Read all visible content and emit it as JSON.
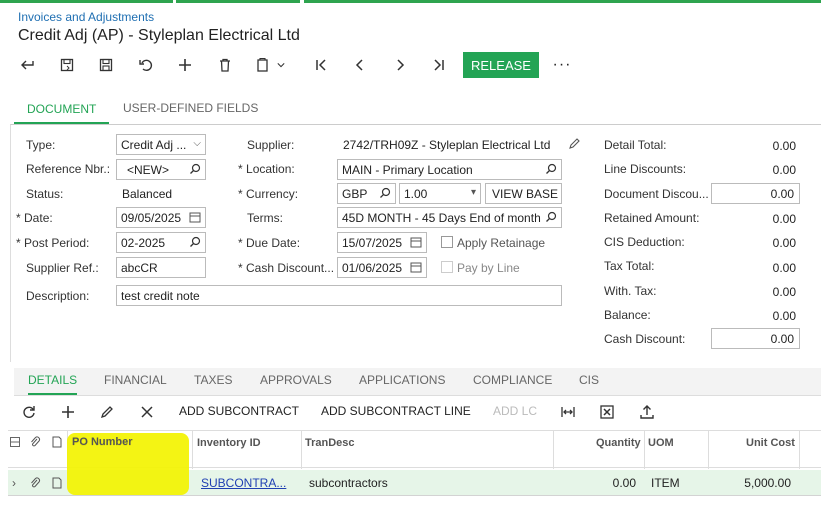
{
  "breadcrumb": "Invoices and Adjustments",
  "title": "Credit Adj (AP) - Styleplan Electrical Ltd",
  "toolbar": {
    "release_label": "RELEASE",
    "more_label": "···"
  },
  "top_tabs": [
    {
      "label": "DOCUMENT",
      "active": true
    },
    {
      "label": "USER-DEFINED FIELDS",
      "active": false
    }
  ],
  "form": {
    "type": {
      "label": "Type:",
      "value": "Credit Adj ..."
    },
    "ref": {
      "label": "Reference Nbr.:",
      "value": "<NEW>"
    },
    "status": {
      "label": "Status:",
      "value": "Balanced"
    },
    "date": {
      "label": "Date:",
      "value": "09/05/2025"
    },
    "post_period": {
      "label": "Post Period:",
      "value": "02-2025"
    },
    "supplier_ref": {
      "label": "Supplier Ref.:",
      "value": "abcCR"
    },
    "description": {
      "label": "Description:",
      "value": "test credit note"
    },
    "supplier": {
      "label": "Supplier:",
      "value": "2742/TRH09Z - Styleplan Electrical Ltd"
    },
    "location": {
      "label": "Location:",
      "value": "MAIN - Primary Location"
    },
    "currency": {
      "label": "Currency:",
      "value": "GBP",
      "rate": "1.00",
      "view_base": "VIEW BASE"
    },
    "terms": {
      "label": "Terms:",
      "value": "45D MONTH - 45 Days End of month"
    },
    "due_date": {
      "label": "Due Date:",
      "value": "15/07/2025"
    },
    "cash_discount_date": {
      "label": "Cash Discount...",
      "value": "01/06/2025"
    },
    "apply_retainage": "Apply Retainage",
    "pay_by_line": "Pay by Line"
  },
  "totals": [
    {
      "label": "Detail Total:",
      "value": "0.00",
      "editable": false
    },
    {
      "label": "Line Discounts:",
      "value": "0.00",
      "editable": false
    },
    {
      "label": "Document Discou...",
      "value": "0.00",
      "editable": true
    },
    {
      "label": "Retained Amount:",
      "value": "0.00",
      "editable": false
    },
    {
      "label": "CIS Deduction:",
      "value": "0.00",
      "editable": false
    },
    {
      "label": "Tax Total:",
      "value": "0.00",
      "editable": false
    },
    {
      "label": "With. Tax:",
      "value": "0.00",
      "editable": false
    },
    {
      "label": "Balance:",
      "value": "0.00",
      "editable": false
    },
    {
      "label": "Cash Discount:",
      "value": "0.00",
      "editable": true
    }
  ],
  "bottom_tabs": [
    {
      "label": "DETAILS",
      "active": true
    },
    {
      "label": "FINANCIAL",
      "active": false
    },
    {
      "label": "TAXES",
      "active": false
    },
    {
      "label": "APPROVALS",
      "active": false
    },
    {
      "label": "APPLICATIONS",
      "active": false
    },
    {
      "label": "COMPLIANCE",
      "active": false
    },
    {
      "label": "CIS",
      "active": false
    }
  ],
  "grid_toolbar": {
    "add_subcontract": "ADD SUBCONTRACT",
    "add_subcontract_line": "ADD SUBCONTRACT LINE",
    "add_lc": "ADD LC"
  },
  "grid": {
    "columns": [
      "PO Number",
      "Inventory ID",
      "TranDesc",
      "Quantity",
      "UOM",
      "Unit Cost"
    ],
    "rows": [
      {
        "po_number": "",
        "inventory_id": "SUBCONTRA...",
        "tran_desc": "subcontractors",
        "quantity": "0.00",
        "uom": "ITEM",
        "unit_cost": "5,000.00"
      }
    ]
  },
  "colors": {
    "accent": "#23a455",
    "link": "#1f6fb2",
    "highlight": "#f3f300",
    "row_selected": "#e6f5e8"
  }
}
